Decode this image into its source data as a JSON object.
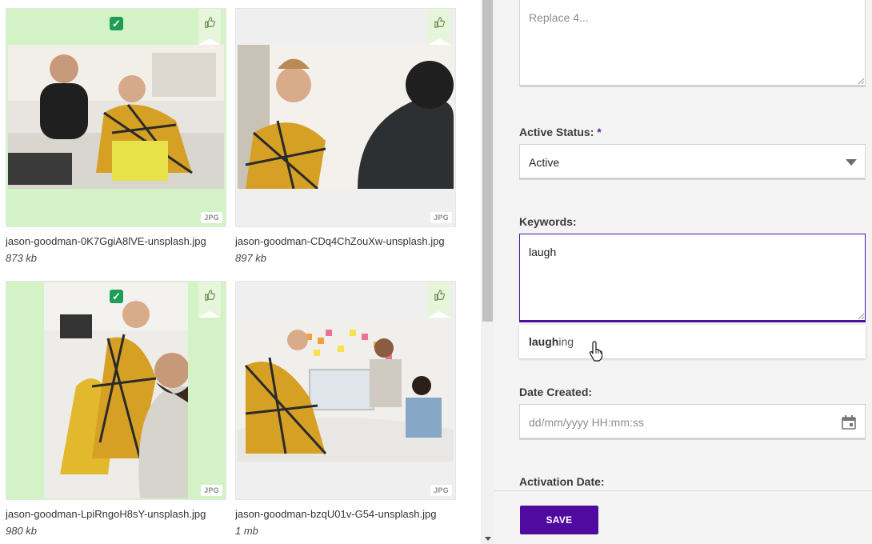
{
  "gallery": {
    "items": [
      {
        "filename": "jason-goodman-0K7GgiA8lVE-unsplash.jpg",
        "size": "873 kb",
        "type": "JPG",
        "selected": true
      },
      {
        "filename": "jason-goodman-CDq4ChZouXw-unsplash.jpg",
        "size": "897 kb",
        "type": "JPG",
        "selected": false
      },
      {
        "filename": "jason-goodman-LpiRngoH8sY-unsplash.jpg",
        "size": "980 kb",
        "type": "JPG",
        "selected": true
      },
      {
        "filename": "jason-goodman-bzqU01v-G54-unsplash.jpg",
        "size": "1 mb",
        "type": "JPG",
        "selected": false
      }
    ],
    "check_glyph": "✓"
  },
  "form": {
    "description_placeholder": "Replace 4...",
    "active_status_label": "Active Status:",
    "required_mark": "*",
    "active_status_value": "Active",
    "keywords_label": "Keywords:",
    "keywords_value": "laugh",
    "suggestion_match": "laugh",
    "suggestion_rest": "ing",
    "date_created_label": "Date Created:",
    "date_created_placeholder": "dd/mm/yyyy HH:mm:ss",
    "activation_date_label": "Activation Date:",
    "save_label": "SAVE"
  },
  "colors": {
    "accent": "#4f0aa0",
    "selected_bg": "#d3f2c6",
    "check_green": "#1f9d55"
  },
  "icons": [
    "thumbs-up-icon",
    "check-icon",
    "calendar-icon",
    "chevron-down-icon",
    "resize-handle-icon",
    "hand-cursor-icon"
  ]
}
